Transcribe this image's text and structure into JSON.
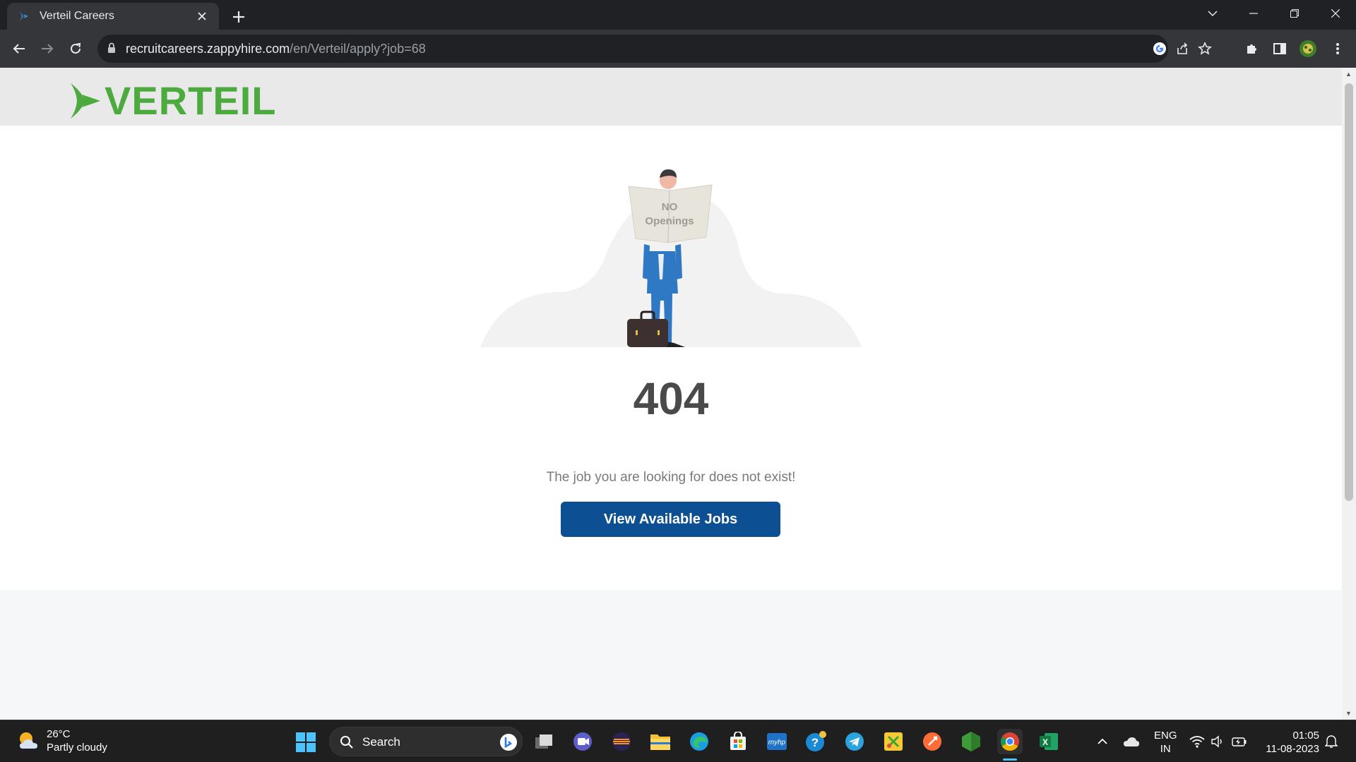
{
  "browser": {
    "tab_title": "Verteil Careers",
    "url_host": "recruitcareers.zappyhire.com",
    "url_path": "/en/Verteil/apply?job=68"
  },
  "site": {
    "logo_text": "VERTEIL",
    "illustration_sign_line1": "NO",
    "illustration_sign_line2": "Openings",
    "error_code": "404",
    "error_message": "The job you are looking for does not exist!",
    "cta_label": "View Available Jobs"
  },
  "taskbar": {
    "weather_temp": "26°C",
    "weather_desc": "Partly cloudy",
    "search_label": "Search",
    "lang_line1": "ENG",
    "lang_line2": "IN",
    "time": "01:05",
    "date": "11-08-2023"
  },
  "colors": {
    "brand_green": "#4caa3f",
    "cta_blue": "#0c4f93",
    "chrome_dark": "#202124",
    "chrome_toolbar": "#35363a"
  }
}
